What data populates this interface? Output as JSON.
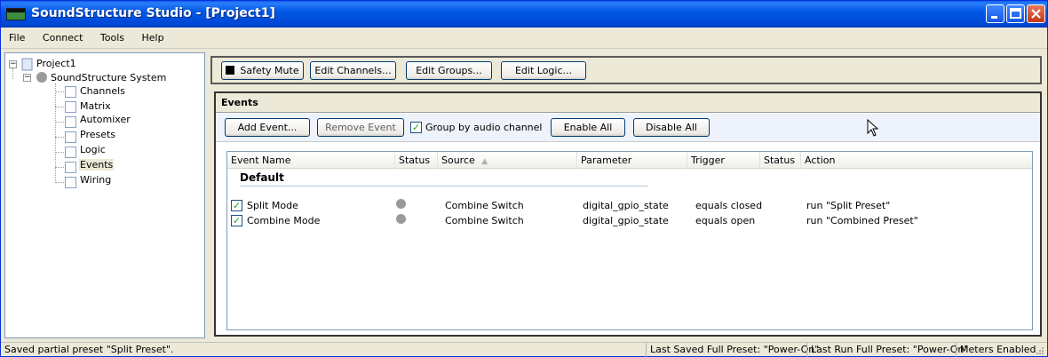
{
  "window": {
    "title": "SoundStructure Studio - [Project1]"
  },
  "menu": [
    "File",
    "Connect",
    "Tools",
    "Help"
  ],
  "tree": {
    "root": "Project1",
    "system": "SoundStructure System",
    "items": [
      "Channels",
      "Matrix",
      "Automixer",
      "Presets",
      "Logic",
      "Events",
      "Wiring"
    ],
    "selected": "Events"
  },
  "toolbar": {
    "safety_mute": "Safety Mute",
    "edit_channels": "Edit Channels...",
    "edit_groups": "Edit Groups...",
    "edit_logic": "Edit Logic..."
  },
  "events": {
    "title": "Events",
    "add": "Add Event...",
    "remove": "Remove Event",
    "group_by": "Group by audio channel",
    "enable_all": "Enable All",
    "disable_all": "Disable All",
    "columns": [
      "Event Name",
      "Status",
      "Source",
      "Parameter",
      "Trigger",
      "Status",
      "Action"
    ],
    "group": "Default",
    "rows": [
      {
        "name": "Split Mode",
        "source": "Combine Switch",
        "parameter": "digital_gpio_state",
        "trigger": "equals closed",
        "action": "run \"Split Preset\""
      },
      {
        "name": "Combine Mode",
        "source": "Combine Switch",
        "parameter": "digital_gpio_state",
        "trigger": "equals open",
        "action": "run \"Combined Preset\""
      }
    ]
  },
  "status": {
    "message": "Saved partial preset \"Split Preset\".",
    "last_saved": "Last Saved Full Preset: \"Power-On\"",
    "last_run": "Last Run Full Preset: \"Power-On\"",
    "meters": "Meters Enabled"
  }
}
